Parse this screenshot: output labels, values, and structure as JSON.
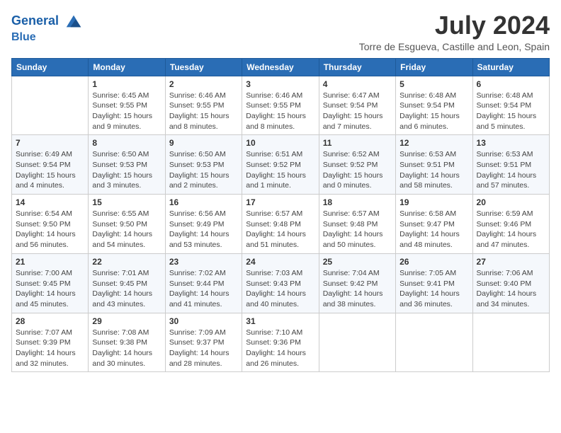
{
  "header": {
    "logo_line1": "General",
    "logo_line2": "Blue",
    "month": "July 2024",
    "location": "Torre de Esgueva, Castille and Leon, Spain"
  },
  "weekdays": [
    "Sunday",
    "Monday",
    "Tuesday",
    "Wednesday",
    "Thursday",
    "Friday",
    "Saturday"
  ],
  "weeks": [
    [
      {
        "day": "",
        "info": ""
      },
      {
        "day": "1",
        "info": "Sunrise: 6:45 AM\nSunset: 9:55 PM\nDaylight: 15 hours\nand 9 minutes."
      },
      {
        "day": "2",
        "info": "Sunrise: 6:46 AM\nSunset: 9:55 PM\nDaylight: 15 hours\nand 8 minutes."
      },
      {
        "day": "3",
        "info": "Sunrise: 6:46 AM\nSunset: 9:55 PM\nDaylight: 15 hours\nand 8 minutes."
      },
      {
        "day": "4",
        "info": "Sunrise: 6:47 AM\nSunset: 9:54 PM\nDaylight: 15 hours\nand 7 minutes."
      },
      {
        "day": "5",
        "info": "Sunrise: 6:48 AM\nSunset: 9:54 PM\nDaylight: 15 hours\nand 6 minutes."
      },
      {
        "day": "6",
        "info": "Sunrise: 6:48 AM\nSunset: 9:54 PM\nDaylight: 15 hours\nand 5 minutes."
      }
    ],
    [
      {
        "day": "7",
        "info": "Sunrise: 6:49 AM\nSunset: 9:54 PM\nDaylight: 15 hours\nand 4 minutes."
      },
      {
        "day": "8",
        "info": "Sunrise: 6:50 AM\nSunset: 9:53 PM\nDaylight: 15 hours\nand 3 minutes."
      },
      {
        "day": "9",
        "info": "Sunrise: 6:50 AM\nSunset: 9:53 PM\nDaylight: 15 hours\nand 2 minutes."
      },
      {
        "day": "10",
        "info": "Sunrise: 6:51 AM\nSunset: 9:52 PM\nDaylight: 15 hours\nand 1 minute."
      },
      {
        "day": "11",
        "info": "Sunrise: 6:52 AM\nSunset: 9:52 PM\nDaylight: 15 hours\nand 0 minutes."
      },
      {
        "day": "12",
        "info": "Sunrise: 6:53 AM\nSunset: 9:51 PM\nDaylight: 14 hours\nand 58 minutes."
      },
      {
        "day": "13",
        "info": "Sunrise: 6:53 AM\nSunset: 9:51 PM\nDaylight: 14 hours\nand 57 minutes."
      }
    ],
    [
      {
        "day": "14",
        "info": "Sunrise: 6:54 AM\nSunset: 9:50 PM\nDaylight: 14 hours\nand 56 minutes."
      },
      {
        "day": "15",
        "info": "Sunrise: 6:55 AM\nSunset: 9:50 PM\nDaylight: 14 hours\nand 54 minutes."
      },
      {
        "day": "16",
        "info": "Sunrise: 6:56 AM\nSunset: 9:49 PM\nDaylight: 14 hours\nand 53 minutes."
      },
      {
        "day": "17",
        "info": "Sunrise: 6:57 AM\nSunset: 9:48 PM\nDaylight: 14 hours\nand 51 minutes."
      },
      {
        "day": "18",
        "info": "Sunrise: 6:57 AM\nSunset: 9:48 PM\nDaylight: 14 hours\nand 50 minutes."
      },
      {
        "day": "19",
        "info": "Sunrise: 6:58 AM\nSunset: 9:47 PM\nDaylight: 14 hours\nand 48 minutes."
      },
      {
        "day": "20",
        "info": "Sunrise: 6:59 AM\nSunset: 9:46 PM\nDaylight: 14 hours\nand 47 minutes."
      }
    ],
    [
      {
        "day": "21",
        "info": "Sunrise: 7:00 AM\nSunset: 9:45 PM\nDaylight: 14 hours\nand 45 minutes."
      },
      {
        "day": "22",
        "info": "Sunrise: 7:01 AM\nSunset: 9:45 PM\nDaylight: 14 hours\nand 43 minutes."
      },
      {
        "day": "23",
        "info": "Sunrise: 7:02 AM\nSunset: 9:44 PM\nDaylight: 14 hours\nand 41 minutes."
      },
      {
        "day": "24",
        "info": "Sunrise: 7:03 AM\nSunset: 9:43 PM\nDaylight: 14 hours\nand 40 minutes."
      },
      {
        "day": "25",
        "info": "Sunrise: 7:04 AM\nSunset: 9:42 PM\nDaylight: 14 hours\nand 38 minutes."
      },
      {
        "day": "26",
        "info": "Sunrise: 7:05 AM\nSunset: 9:41 PM\nDaylight: 14 hours\nand 36 minutes."
      },
      {
        "day": "27",
        "info": "Sunrise: 7:06 AM\nSunset: 9:40 PM\nDaylight: 14 hours\nand 34 minutes."
      }
    ],
    [
      {
        "day": "28",
        "info": "Sunrise: 7:07 AM\nSunset: 9:39 PM\nDaylight: 14 hours\nand 32 minutes."
      },
      {
        "day": "29",
        "info": "Sunrise: 7:08 AM\nSunset: 9:38 PM\nDaylight: 14 hours\nand 30 minutes."
      },
      {
        "day": "30",
        "info": "Sunrise: 7:09 AM\nSunset: 9:37 PM\nDaylight: 14 hours\nand 28 minutes."
      },
      {
        "day": "31",
        "info": "Sunrise: 7:10 AM\nSunset: 9:36 PM\nDaylight: 14 hours\nand 26 minutes."
      },
      {
        "day": "",
        "info": ""
      },
      {
        "day": "",
        "info": ""
      },
      {
        "day": "",
        "info": ""
      }
    ]
  ]
}
